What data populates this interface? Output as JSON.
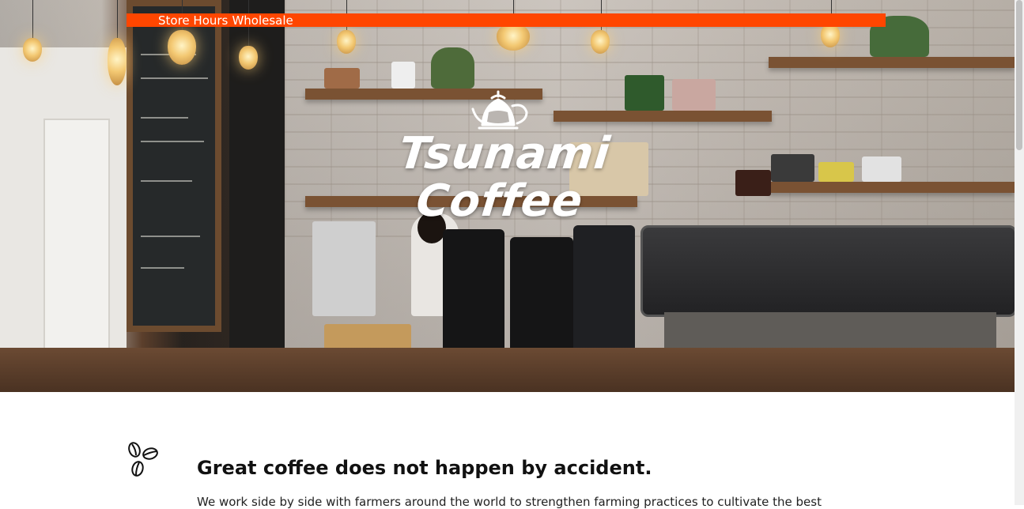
{
  "nav": {
    "links": [
      {
        "label": "Store Hours"
      },
      {
        "label": "Wholesale"
      }
    ],
    "bar_color": "#ff4600"
  },
  "hero": {
    "logo_line1": "Tsunami",
    "logo_line2": "Coffee",
    "logo_icon": "pour-over-kettle-icon"
  },
  "intro": {
    "icon": "coffee-beans-icon",
    "heading": "Great coffee does not happen by accident.",
    "body": "We work side by side with farmers around the world to strengthen farming practices to cultivate the best"
  }
}
